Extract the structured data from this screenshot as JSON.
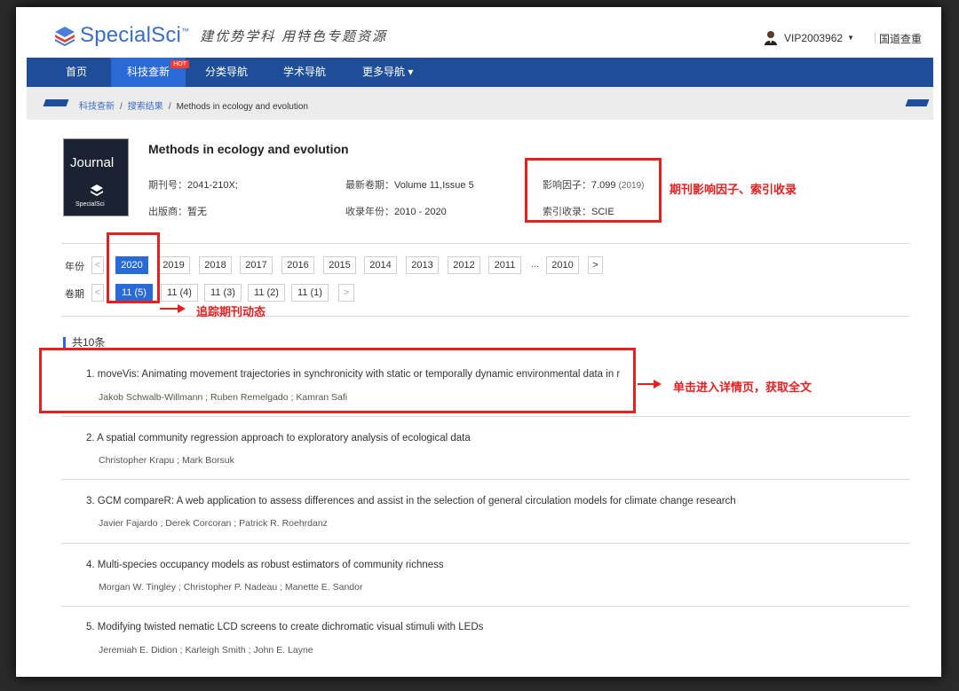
{
  "header": {
    "logo_text": "SpecialSci",
    "logo_tm": "™",
    "slogan": "建优势学科 用特色专题资源",
    "user": "VIP2003962",
    "extra_link": "国道查重"
  },
  "nav": {
    "items": [
      "首页",
      "科技查新",
      "分类导航",
      "学术导航",
      "更多导航 ▾"
    ],
    "hot_badge": "HOT"
  },
  "breadcrumb": {
    "items": [
      "科技查新",
      "搜索结果",
      "Methods in ecology and evolution"
    ]
  },
  "journal": {
    "cover_title": "Journal",
    "cover_brand": "SpecialSci",
    "title": "Methods in ecology and evolution",
    "issn_label": "期刊号：",
    "issn": "2041-210X;",
    "latest_label": "最新卷期：",
    "latest": "Volume 11,Issue 5",
    "if_label": "影响因子：",
    "if_value": "7.099",
    "if_year": "(2019)",
    "publisher_label": "出版商：",
    "publisher": "暂无",
    "years_label": "收录年份：",
    "years": "2010 - 2020",
    "index_label": "索引收录：",
    "index": "SCIE"
  },
  "filters": {
    "year_label": "年份",
    "years": [
      "2020",
      "2019",
      "2018",
      "2017",
      "2016",
      "2015",
      "2014",
      "2013",
      "2012",
      "2011",
      "...",
      "2010"
    ],
    "issue_label": "卷期",
    "issues": [
      "11 (5)",
      "11 (4)",
      "11 (3)",
      "11 (2)",
      "11 (1)"
    ],
    "prev": "<",
    "next": ">"
  },
  "results": {
    "count": "共10条",
    "articles": [
      {
        "title": "1. moveVis: Animating movement trajectories in synchronicity with static or temporally dynamic environmental data in r",
        "authors": "Jakob Schwalb-Willmann ; Ruben Remelgado ; Kamran Safi"
      },
      {
        "title": "2. A spatial community regression approach to exploratory analysis of ecological data",
        "authors": "Christopher Krapu ; Mark Borsuk"
      },
      {
        "title": "3. GCM compareR: A web application to assess differences and assist in the selection of general circulation models for climate change research",
        "authors": "Javier Fajardo ; Derek Corcoran ; Patrick R. Roehrdanz"
      },
      {
        "title": "4. Multi-species occupancy models as robust estimators of community richness",
        "authors": "Morgan W. Tingley ; Christopher P. Nadeau ; Manette E. Sandor"
      },
      {
        "title": "5. Modifying twisted nematic LCD screens to create dichromatic visual stimuli with LEDs",
        "authors": "Jeremiah E. Didion ; Karleigh Smith ; John E. Layne"
      }
    ]
  },
  "annotations": {
    "impact": "期刊影响因子、索引收录",
    "track": "追踪期刊动态",
    "detail": "单击进入详情页，获取全文"
  },
  "colors": {
    "accent": "#2a6ad6",
    "nav": "#1f4e98",
    "annotation": "#e42020"
  }
}
